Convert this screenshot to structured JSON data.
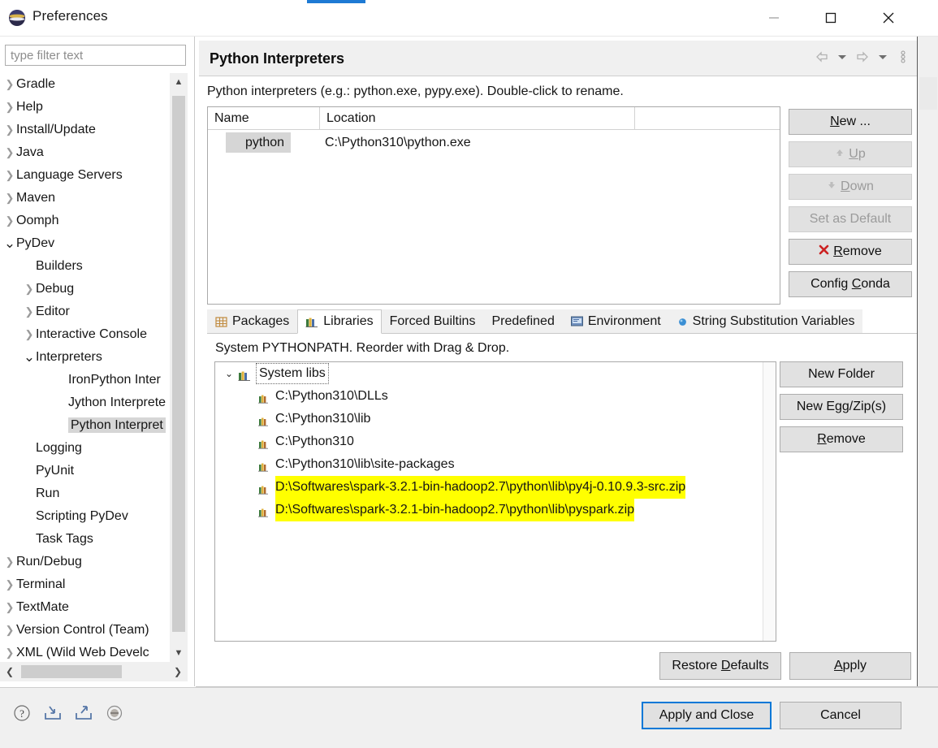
{
  "window": {
    "title": "Preferences",
    "app_icon": "eclipse-icon",
    "minimize_label": "Minimize",
    "maximize_label": "Maximize",
    "close_label": "Close"
  },
  "sidebar": {
    "filter": {
      "placeholder": "type filter text",
      "value": ""
    },
    "items": [
      {
        "label": "Gradle",
        "depth": 0,
        "state": "collapsed"
      },
      {
        "label": "Help",
        "depth": 0,
        "state": "collapsed"
      },
      {
        "label": "Install/Update",
        "depth": 0,
        "state": "collapsed"
      },
      {
        "label": "Java",
        "depth": 0,
        "state": "collapsed"
      },
      {
        "label": "Language Servers",
        "depth": 0,
        "state": "collapsed"
      },
      {
        "label": "Maven",
        "depth": 0,
        "state": "collapsed"
      },
      {
        "label": "Oomph",
        "depth": 0,
        "state": "collapsed"
      },
      {
        "label": "PyDev",
        "depth": 0,
        "state": "expanded"
      },
      {
        "label": "Builders",
        "depth": 1,
        "state": "leaf"
      },
      {
        "label": "Debug",
        "depth": 1,
        "state": "collapsed"
      },
      {
        "label": "Editor",
        "depth": 1,
        "state": "collapsed"
      },
      {
        "label": "Interactive Console",
        "depth": 1,
        "state": "collapsed"
      },
      {
        "label": "Interpreters",
        "depth": 1,
        "state": "expanded"
      },
      {
        "label": "IronPython Inter",
        "depth": 2,
        "state": "leaf"
      },
      {
        "label": "Jython Interprete",
        "depth": 2,
        "state": "leaf"
      },
      {
        "label": "Python Interpret",
        "depth": 2,
        "state": "leaf",
        "selected": true
      },
      {
        "label": "Logging",
        "depth": 1,
        "state": "leaf"
      },
      {
        "label": "PyUnit",
        "depth": 1,
        "state": "leaf"
      },
      {
        "label": "Run",
        "depth": 1,
        "state": "leaf"
      },
      {
        "label": "Scripting PyDev",
        "depth": 1,
        "state": "leaf"
      },
      {
        "label": "Task Tags",
        "depth": 1,
        "state": "leaf"
      },
      {
        "label": "Run/Debug",
        "depth": 0,
        "state": "collapsed"
      },
      {
        "label": "Terminal",
        "depth": 0,
        "state": "collapsed"
      },
      {
        "label": "TextMate",
        "depth": 0,
        "state": "collapsed"
      },
      {
        "label": "Version Control (Team)",
        "depth": 0,
        "state": "collapsed"
      },
      {
        "label": "XML (Wild Web Develc",
        "depth": 0,
        "state": "collapsed"
      }
    ]
  },
  "page": {
    "title": "Python Interpreters",
    "description": "Python interpreters (e.g.: python.exe, pypy.exe).   Double-click to rename.",
    "nav_icons": [
      "back-arrow-icon",
      "back-dropdown-icon",
      "forward-arrow-icon",
      "forward-dropdown-icon",
      "view-menu-icon"
    ]
  },
  "interpreter_table": {
    "columns": [
      "Name",
      "Location"
    ],
    "rows": [
      {
        "icon": "python-icon",
        "name": "python",
        "location": "C:\\Python310\\python.exe",
        "selected": true
      }
    ]
  },
  "interpreter_buttons": [
    {
      "label": "New ...",
      "mnemonic": "N",
      "enabled": true,
      "icon": ""
    },
    {
      "label": "Up",
      "mnemonic": "U",
      "enabled": false,
      "icon": "up-arrow-icon"
    },
    {
      "label": "Down",
      "mnemonic": "D",
      "enabled": false,
      "icon": "down-arrow-icon"
    },
    {
      "label": "Set as Default",
      "mnemonic": "",
      "enabled": false,
      "icon": ""
    },
    {
      "label": "Remove",
      "mnemonic": "R",
      "enabled": true,
      "icon": "remove-x-icon"
    },
    {
      "label": "Config Conda",
      "mnemonic": "C",
      "enabled": true,
      "icon": ""
    }
  ],
  "tabs": [
    {
      "label": "Packages",
      "icon": "packages-icon",
      "active": false
    },
    {
      "label": "Libraries",
      "icon": "libraries-icon",
      "active": true
    },
    {
      "label": "Forced Builtins",
      "icon": "",
      "active": false
    },
    {
      "label": "Predefined",
      "icon": "",
      "active": false
    },
    {
      "label": "Environment",
      "icon": "environment-icon",
      "active": false
    },
    {
      "label": "String Substitution Variables",
      "icon": "variables-icon",
      "active": false
    }
  ],
  "libraries": {
    "description": "System PYTHONPATH.   Reorder with Drag & Drop.",
    "root": {
      "label": "System libs",
      "icon": "system-libs-icon",
      "expanded": true,
      "focused": true
    },
    "entries": [
      {
        "label": "C:\\Python310\\DLLs",
        "icon": "library-icon",
        "highlighted": false
      },
      {
        "label": "C:\\Python310\\lib",
        "icon": "library-icon",
        "highlighted": false
      },
      {
        "label": "C:\\Python310",
        "icon": "library-icon",
        "highlighted": false
      },
      {
        "label": "C:\\Python310\\lib\\site-packages",
        "icon": "library-icon",
        "highlighted": false
      },
      {
        "label": "D:\\Softwares\\spark-3.2.1-bin-hadoop2.7\\python\\lib\\py4j-0.10.9.3-src.zip",
        "icon": "library-icon",
        "highlighted": true
      },
      {
        "label": "D:\\Softwares\\spark-3.2.1-bin-hadoop2.7\\python\\lib\\pyspark.zip",
        "icon": "library-icon",
        "highlighted": true
      }
    ],
    "buttons": [
      {
        "label": "New Folder",
        "mnemonic": "",
        "enabled": true
      },
      {
        "label": "New Egg/Zip(s)",
        "mnemonic": "",
        "enabled": true
      },
      {
        "label": "Remove",
        "mnemonic": "R",
        "enabled": true
      }
    ]
  },
  "page_buttons": [
    {
      "label": "Restore Defaults",
      "mnemonic": "D",
      "enabled": true
    },
    {
      "label": "Apply",
      "mnemonic": "A",
      "enabled": true
    }
  ],
  "footer": {
    "icons": [
      "help-icon",
      "import-icon",
      "export-icon",
      "oomph-recorder-icon"
    ],
    "apply_and_close": "Apply and Close",
    "cancel": "Cancel",
    "focus_color": "#0078d7"
  },
  "colors": {
    "highlight_yellow": "#ffff00",
    "selection_gray": "#d6d6d6",
    "accent_blue": "#1e7ad4",
    "button_face": "#e1e1e1"
  }
}
